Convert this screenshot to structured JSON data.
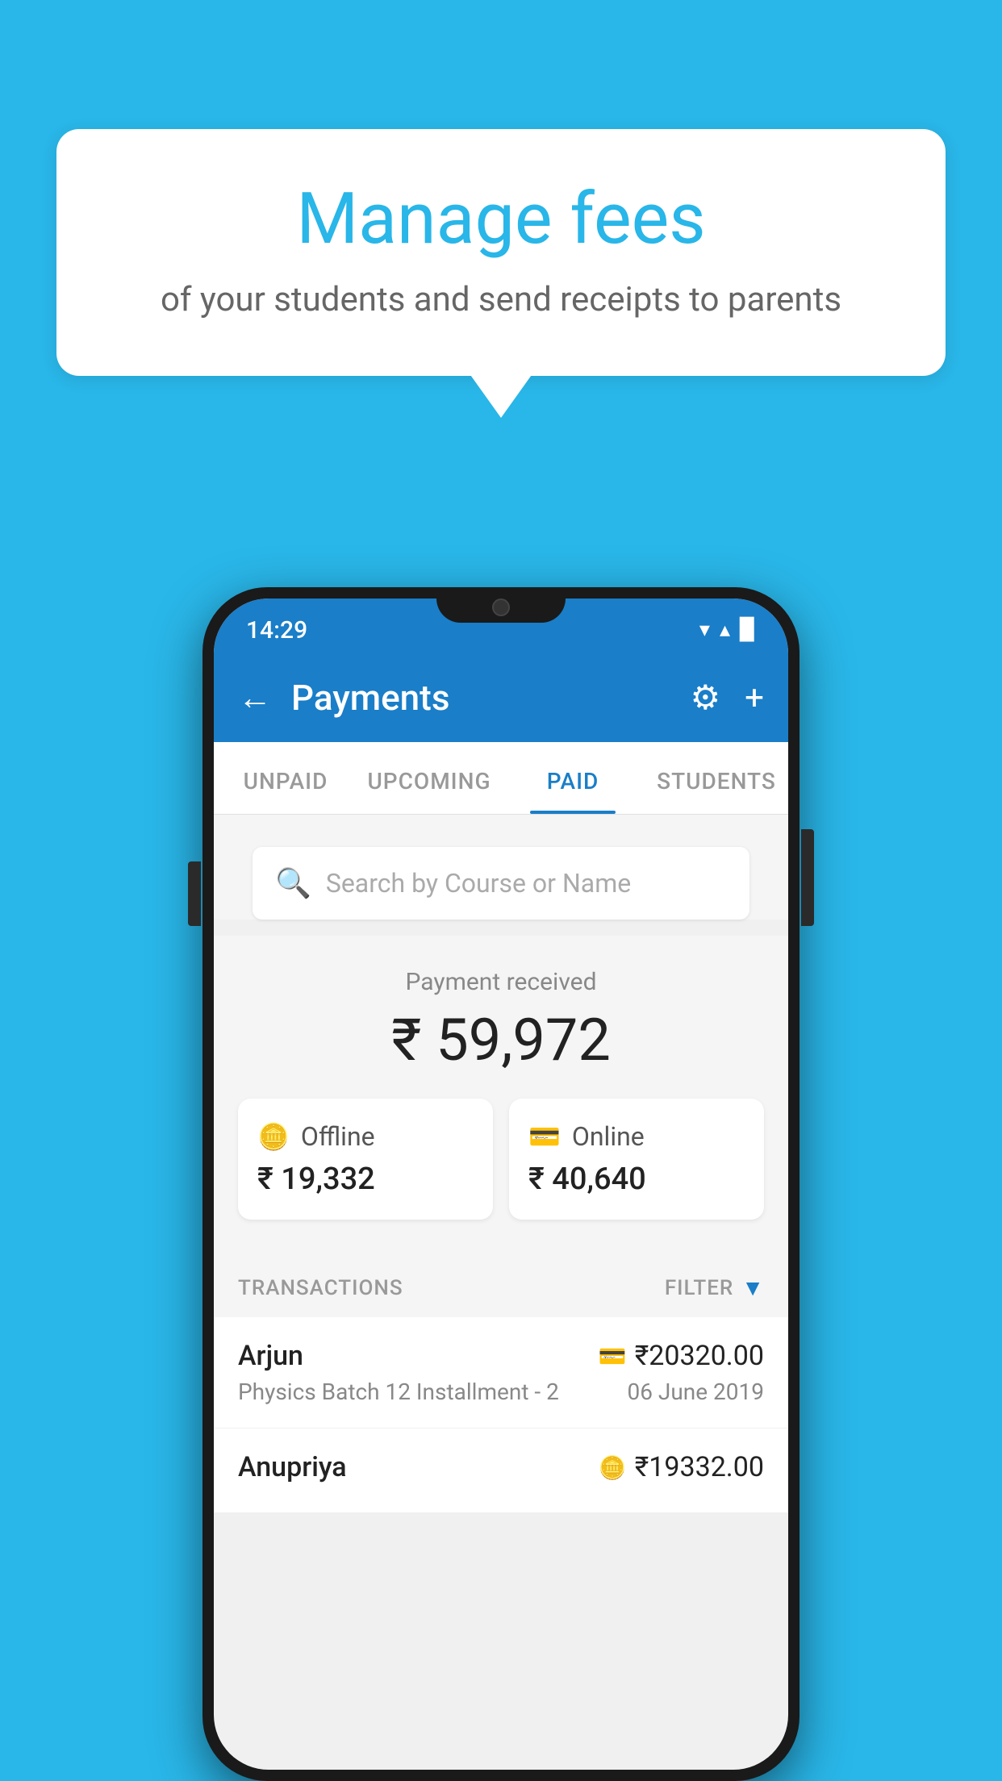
{
  "background_color": "#29b6e8",
  "speech_bubble": {
    "title": "Manage fees",
    "subtitle": "of your students and send receipts to parents"
  },
  "phone": {
    "status_bar": {
      "time": "14:29",
      "wifi": "▼",
      "signal": "▲",
      "battery": "▉"
    },
    "app_bar": {
      "title": "Payments",
      "back_label": "←",
      "gear_label": "⚙",
      "plus_label": "+"
    },
    "tabs": [
      {
        "label": "UNPAID",
        "active": false
      },
      {
        "label": "UPCOMING",
        "active": false
      },
      {
        "label": "PAID",
        "active": true
      },
      {
        "label": "STUDENTS",
        "active": false
      }
    ],
    "search": {
      "placeholder": "Search by Course or Name"
    },
    "payment_section": {
      "label": "Payment received",
      "amount": "₹ 59,972",
      "offline_label": "Offline",
      "offline_amount": "₹ 19,332",
      "online_label": "Online",
      "online_amount": "₹ 40,640"
    },
    "transactions": {
      "header": "TRANSACTIONS",
      "filter": "FILTER",
      "rows": [
        {
          "name": "Arjun",
          "amount": "₹20320.00",
          "course": "Physics Batch 12 Installment - 2",
          "date": "06 June 2019",
          "payment_type": "online"
        },
        {
          "name": "Anupriya",
          "amount": "₹19332.00",
          "course": "",
          "date": "",
          "payment_type": "offline"
        }
      ]
    }
  }
}
